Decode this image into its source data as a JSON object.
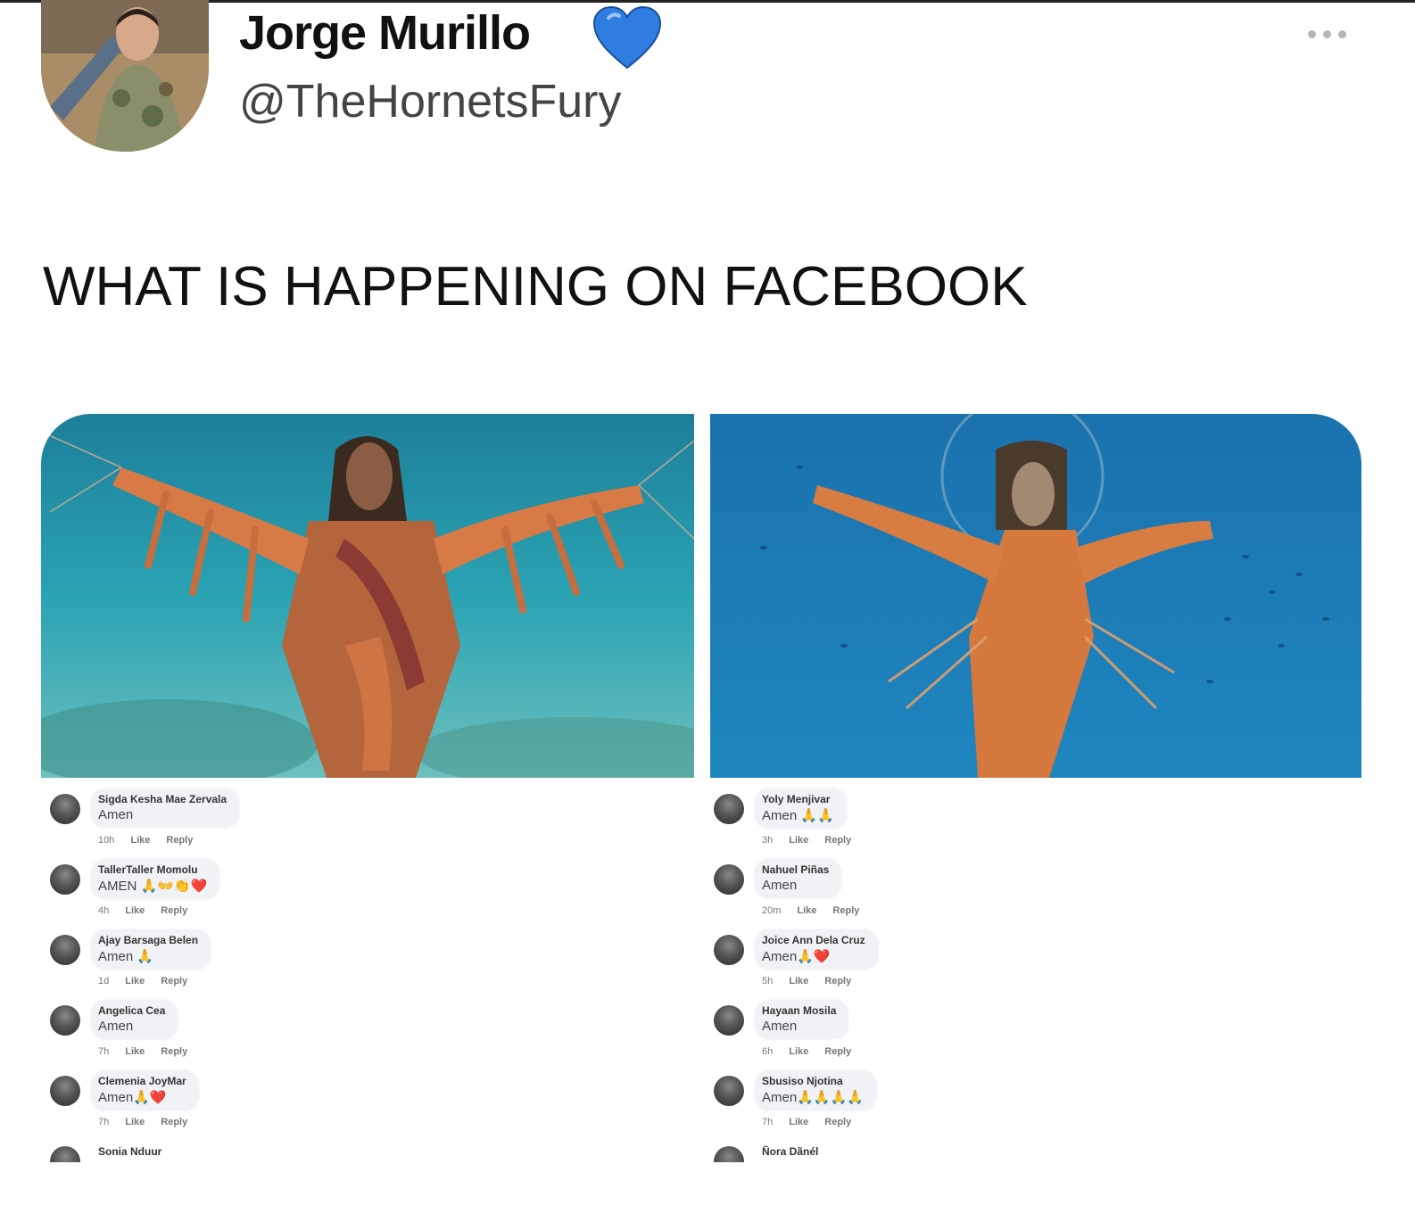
{
  "tweet": {
    "display_name": "Jorge Murillo",
    "verified_icon": "blue-heart-icon",
    "handle": "@TheHornetsFury",
    "text": "WHAT IS HAPPENING ON FACEBOOK",
    "colors": {
      "heart": "#2f7de1",
      "text": "#111111",
      "handle": "#444444"
    }
  },
  "images": {
    "left": {
      "description_icon": "shrimp-jesus-statue-image",
      "water_color": "#2aa3b3"
    },
    "right": {
      "description_icon": "shrimp-jesus-statue-image",
      "water_color": "#1c78b8"
    }
  },
  "comments_left": [
    {
      "name": "Sigda Kesha Mae Zervala",
      "text": "Amen",
      "time": "10h",
      "like": "Like",
      "reply": "Reply"
    },
    {
      "name": "TallerTaller Momolu",
      "text": "AMEN 🙏👐👏❤️",
      "time": "4h",
      "like": "Like",
      "reply": "Reply"
    },
    {
      "name": "Ajay Barsaga Belen",
      "text": "Amen 🙏",
      "time": "1d",
      "like": "Like",
      "reply": "Reply"
    },
    {
      "name": "Angelica Cea",
      "text": "Amen",
      "time": "7h",
      "like": "Like",
      "reply": "Reply"
    },
    {
      "name": "Clemenia JoyMar",
      "text": "Amen🙏❤️",
      "time": "7h",
      "like": "Like",
      "reply": "Reply"
    },
    {
      "name": "Sonia Nduur"
    }
  ],
  "comments_right": [
    {
      "name": "Yoly Menjivar",
      "text": "Amen 🙏🙏",
      "time": "3h",
      "like": "Like",
      "reply": "Reply"
    },
    {
      "name": "Nahuel Piñas",
      "text": "Amen",
      "time": "20m",
      "like": "Like",
      "reply": "Reply"
    },
    {
      "name": "Joice Ann Dela Cruz",
      "text": "Amen🙏❤️",
      "time": "5h",
      "like": "Like",
      "reply": "Reply"
    },
    {
      "name": "Hayaan Mosila",
      "text": "Amen",
      "time": "6h",
      "like": "Like",
      "reply": "Reply"
    },
    {
      "name": "Sbusiso Njotina",
      "text": "Amen🙏🙏🙏🙏",
      "time": "7h",
      "like": "Like",
      "reply": "Reply"
    },
    {
      "name": "Ñora Dãnél"
    }
  ]
}
